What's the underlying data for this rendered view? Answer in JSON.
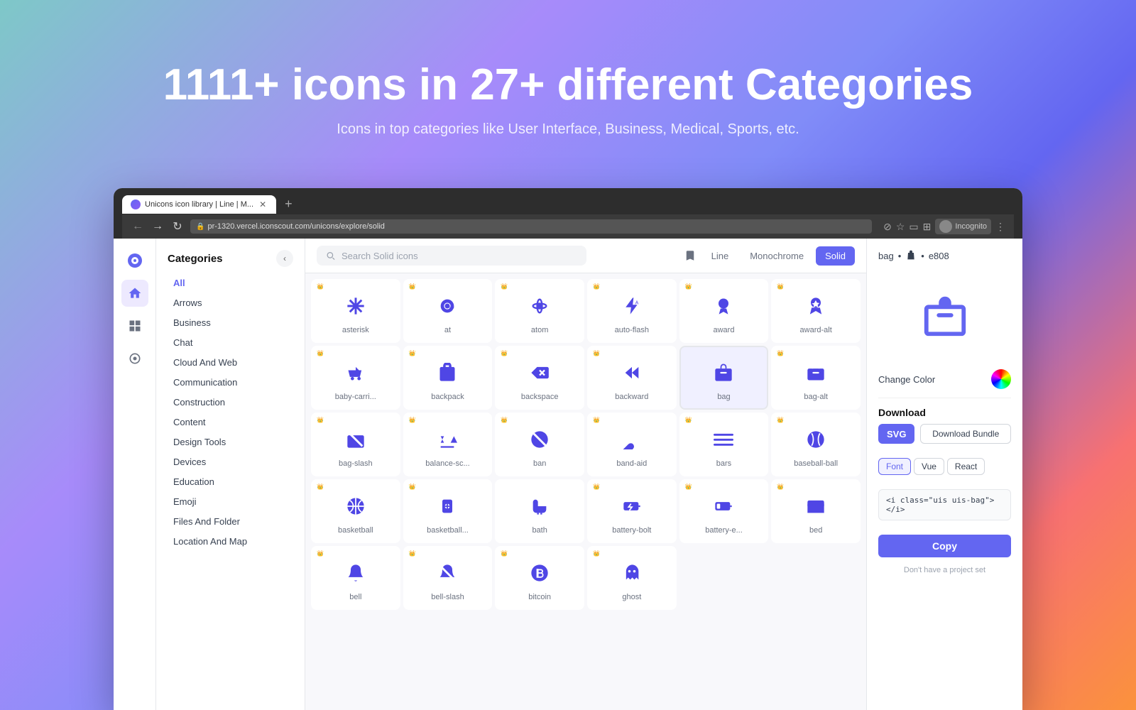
{
  "hero": {
    "title": "1111+ icons in 27+ different Categories",
    "subtitle": "Icons in top categories like User Interface, Business, Medical, Sports, etc."
  },
  "browser": {
    "tab_title": "Unicons icon library | Line | M...",
    "url": "pr-1320.vercel.iconscout.com/unicons/explore/solid",
    "incognito_label": "Incognito"
  },
  "search": {
    "placeholder": "Search Solid icons"
  },
  "style_switcher": {
    "line": "Line",
    "monochrome": "Monochrome",
    "solid": "Solid"
  },
  "header_info": {
    "name": "bag",
    "icon_name": "🧳",
    "code": "e808"
  },
  "categories": {
    "title": "Categories",
    "items": [
      {
        "label": "All",
        "active": true
      },
      {
        "label": "Arrows",
        "active": false
      },
      {
        "label": "Business",
        "active": false
      },
      {
        "label": "Chat",
        "active": false
      },
      {
        "label": "Cloud And Web",
        "active": false
      },
      {
        "label": "Communication",
        "active": false
      },
      {
        "label": "Construction",
        "active": false
      },
      {
        "label": "Content",
        "active": false
      },
      {
        "label": "Design Tools",
        "active": false
      },
      {
        "label": "Devices",
        "active": false
      },
      {
        "label": "Education",
        "active": false
      },
      {
        "label": "Emoji",
        "active": false
      },
      {
        "label": "Files And Folder",
        "active": false
      },
      {
        "label": "Location And Map",
        "active": false
      }
    ]
  },
  "icons_grid": [
    {
      "name": "asterisk",
      "symbol": "✳",
      "premium": true
    },
    {
      "name": "at",
      "symbol": "@",
      "premium": true
    },
    {
      "name": "atom",
      "symbol": "⚛",
      "premium": true
    },
    {
      "name": "auto-flash",
      "symbol": "⚡",
      "premium": true
    },
    {
      "name": "award",
      "symbol": "🏆",
      "premium": true
    },
    {
      "name": "award-alt",
      "symbol": "🎖",
      "premium": true
    },
    {
      "name": "baby-carri...",
      "symbol": "🛒",
      "premium": true
    },
    {
      "name": "backpack",
      "symbol": "🎒",
      "premium": true
    },
    {
      "name": "backspace",
      "symbol": "⌫",
      "premium": true
    },
    {
      "name": "backward",
      "symbol": "⏪",
      "premium": true
    },
    {
      "name": "bag",
      "symbol": "👜",
      "premium": false,
      "selected": true
    },
    {
      "name": "bag-alt",
      "symbol": "💼",
      "premium": true
    },
    {
      "name": "bag-slash",
      "symbol": "🚫",
      "premium": true
    },
    {
      "name": "balance-sc...",
      "symbol": "⚖",
      "premium": true
    },
    {
      "name": "ban",
      "symbol": "🚫",
      "premium": true
    },
    {
      "name": "band-aid",
      "symbol": "🩹",
      "premium": true
    },
    {
      "name": "bars",
      "symbol": "☰",
      "premium": true
    },
    {
      "name": "baseball-ball",
      "symbol": "⚾",
      "premium": true
    },
    {
      "name": "basketball",
      "symbol": "🏀",
      "premium": true
    },
    {
      "name": "basketball...",
      "symbol": "🏀",
      "premium": true
    },
    {
      "name": "bath",
      "symbol": "🛁",
      "premium": false
    },
    {
      "name": "battery-bolt",
      "symbol": "🔋",
      "premium": true
    },
    {
      "name": "battery-e...",
      "symbol": "🔋",
      "premium": true
    },
    {
      "name": "bed",
      "symbol": "🛏",
      "premium": true
    },
    {
      "name": "bell",
      "symbol": "🔔",
      "premium": true
    },
    {
      "name": "bell-slash",
      "symbol": "🔕",
      "premium": true
    },
    {
      "name": "bitcoin",
      "symbol": "₿",
      "premium": true
    },
    {
      "name": "ghost",
      "symbol": "👻",
      "premium": true
    }
  ],
  "right_panel": {
    "icon_name": "bag",
    "icon_code": "e808",
    "change_color_label": "Change Color",
    "download_label": "Download",
    "svg_btn": "SVG",
    "bundle_btn": "Download Bundle",
    "font_tab": "Font",
    "vue_tab": "Vue",
    "react_tab": "React",
    "code_snippet": "<i class=\"uis uis-bag\"></i>",
    "copy_btn": "Copy",
    "no_project_text": "Don't have a project set"
  }
}
